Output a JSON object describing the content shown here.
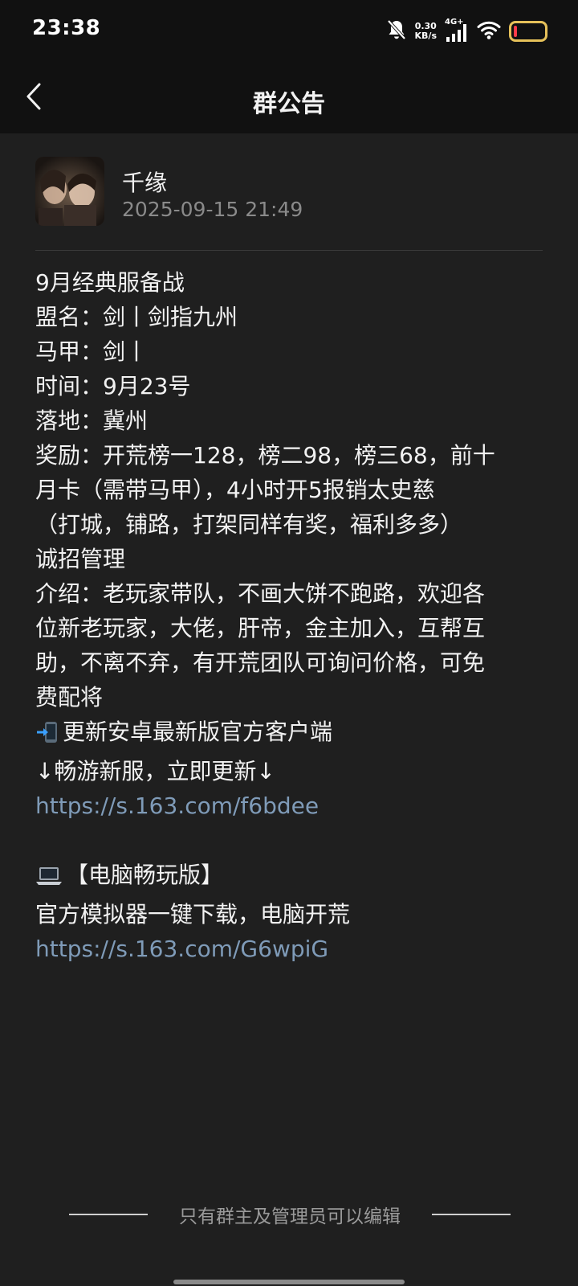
{
  "status_bar": {
    "time": "23:38",
    "net_speed_value": "0.30",
    "net_speed_unit": "KB/s",
    "network_type": "4G+",
    "icons": [
      "bell-muted-icon",
      "signal-icon",
      "wifi-icon",
      "battery-icon"
    ],
    "battery_level": 0.08,
    "battery_low_color": "#ff3b4a",
    "battery_outline_color": "#e6c15a"
  },
  "header": {
    "title": "群公告",
    "back_icon": "chevron-left-icon"
  },
  "announcement": {
    "author": "千缘",
    "timestamp": "2025-09-15 21:49",
    "lines": [
      "9月经典服备战",
      "盟名：剑丨剑指九州",
      "马甲：剑丨",
      "时间：9月23号",
      "落地：冀州",
      "奖励：开荒榜一128，榜二98，榜三68，前十",
      "月卡（需带马甲），4小时开5报销太史慈",
      "（打城，铺路，打架同样有奖，福利多多）",
      "诚招管理",
      "介绍：老玩家带队，不画大饼不跑路，欢迎各",
      "位新老玩家，大佬，肝帝，金主加入，互帮互",
      "助，不离不弃，有开荒团队可询问价格，可免",
      "费配将"
    ],
    "update_line": "更新安卓最新版官方客户端",
    "update_icon": "mobile-arrow-icon",
    "update_sub_line": "↓畅游新服，立即更新↓",
    "link_android": "https://s.163.com/f6bdee",
    "pc_line": "【电脑畅玩版】",
    "pc_icon": "laptop-icon",
    "pc_sub_line": "官方模拟器一键下载，电脑开荒",
    "link_pc": "https://s.163.com/G6wpiG",
    "link_color": "#7f9bb8"
  },
  "footer": {
    "note": "只有群主及管理员可以编辑"
  }
}
